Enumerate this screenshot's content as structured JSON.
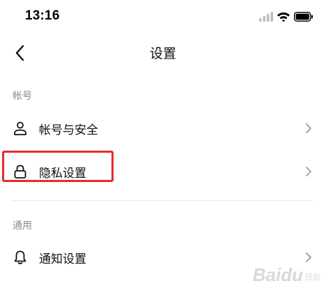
{
  "status_bar": {
    "time": "13:16",
    "icons": [
      "cellular-signal-icon",
      "wifi-icon",
      "battery-icon"
    ]
  },
  "nav": {
    "back_icon": "chevron-left-icon",
    "title": "设置"
  },
  "sections": [
    {
      "header": "帐号",
      "items": [
        {
          "label": "帐号与安全",
          "icon": "person-icon"
        },
        {
          "label": "隐私设置",
          "icon": "lock-icon",
          "highlighted": true
        }
      ]
    },
    {
      "header": "通用",
      "items": [
        {
          "label": "通知设置",
          "icon": "bell-icon"
        }
      ]
    }
  ],
  "colors": {
    "highlight": "#e8292c",
    "section_header": "#8a8a8a",
    "divider": "#e6e6e6",
    "chevron": "#9a9a9a"
  },
  "watermark": {
    "text": "Baidu",
    "sub": "经验"
  }
}
